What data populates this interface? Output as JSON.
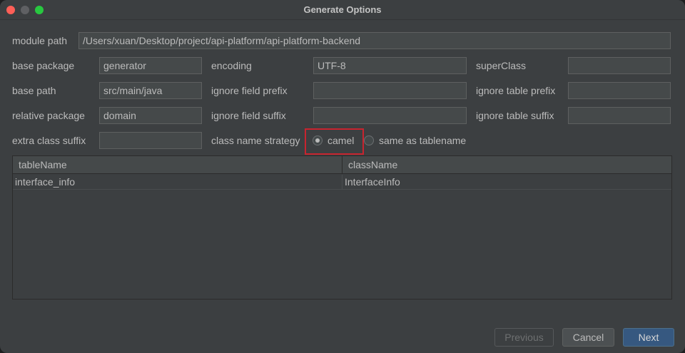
{
  "window": {
    "title": "Generate Options"
  },
  "form": {
    "module_path": {
      "label": "module path",
      "value": "/Users/xuan/Desktop/project/api-platform/api-platform-backend"
    },
    "base_package": {
      "label": "base package",
      "value": "generator"
    },
    "encoding": {
      "label": "encoding",
      "value": "UTF-8"
    },
    "super_class": {
      "label": "superClass",
      "value": ""
    },
    "base_path": {
      "label": "base path",
      "value": "src/main/java"
    },
    "ignore_field_prefix": {
      "label": "ignore field prefix",
      "value": ""
    },
    "ignore_table_prefix": {
      "label": "ignore table prefix",
      "value": ""
    },
    "relative_package": {
      "label": "relative package",
      "value": "domain"
    },
    "ignore_field_suffix": {
      "label": "ignore field suffix",
      "value": ""
    },
    "ignore_table_suffix": {
      "label": "ignore table suffix",
      "value": ""
    },
    "extra_class_suffix": {
      "label": "extra class suffix",
      "value": ""
    },
    "class_name_strategy": {
      "label": "class name strategy",
      "options": [
        {
          "label": "camel",
          "selected": true
        },
        {
          "label": "same as tablename",
          "selected": false
        }
      ]
    }
  },
  "table": {
    "columns": [
      "tableName",
      "className"
    ],
    "rows": [
      [
        "interface_info",
        "InterfaceInfo"
      ]
    ]
  },
  "buttons": {
    "previous": "Previous",
    "cancel": "Cancel",
    "next": "Next"
  },
  "colors": {
    "window_bg": "#3c3f41",
    "field_bg": "#45494a",
    "primary_button": "#365880",
    "highlight_box": "#c8242f"
  }
}
